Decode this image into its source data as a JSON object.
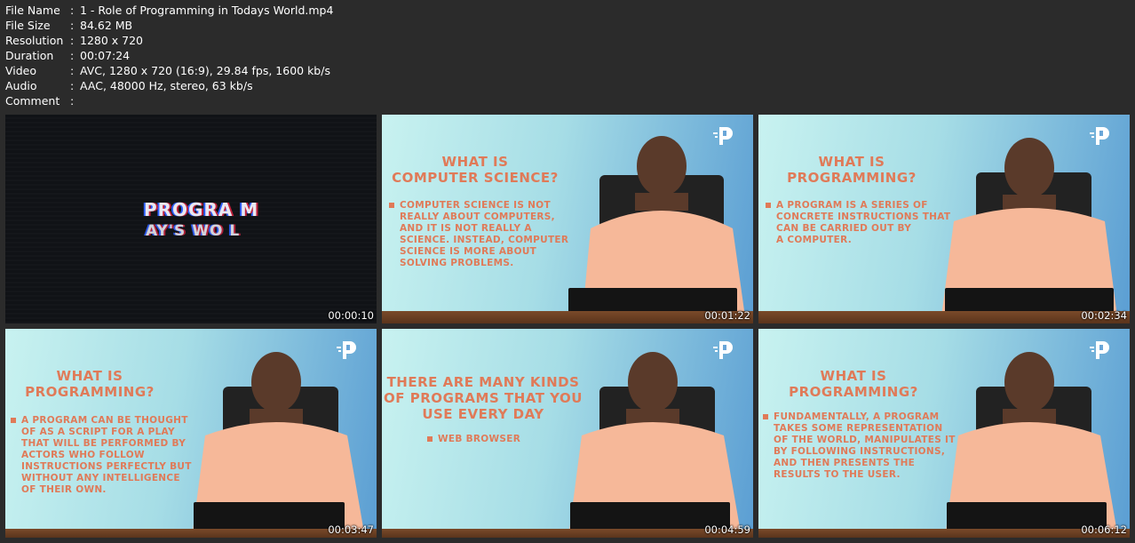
{
  "info": [
    {
      "key": "File Name",
      "value": "1 - Role of Programming in Todays World.mp4"
    },
    {
      "key": "File Size",
      "value": "84.62 MB"
    },
    {
      "key": "Resolution",
      "value": "1280 x 720"
    },
    {
      "key": "Duration",
      "value": "00:07:24"
    },
    {
      "key": "Video",
      "value": "AVC, 1280 x 720 (16:9), 29.84 fps, 1600 kb/s"
    },
    {
      "key": "Audio",
      "value": "AAC, 48000 Hz, stereo, 63 kb/s"
    },
    {
      "key": "Comment",
      "value": ""
    }
  ],
  "colon": ":",
  "thumbs": [
    {
      "time": "00:00:10",
      "line1": "PROGRA  M",
      "line2": "AY'S WO L"
    },
    {
      "time": "00:01:22",
      "title": "WHAT IS\nCOMPUTER SCIENCE?",
      "bullet": "COMPUTER SCIENCE IS NOT\nREALLY ABOUT COMPUTERS,\nAND IT IS NOT REALLY A\nSCIENCE. INSTEAD, COMPUTER\nSCIENCE IS MORE ABOUT\nSOLVING PROBLEMS."
    },
    {
      "time": "00:02:34",
      "title": "WHAT IS\nPROGRAMMING?",
      "bullet": "A PROGRAM IS A SERIES OF\nCONCRETE INSTRUCTIONS THAT\nCAN BE CARRIED OUT BY\nA COMPUTER."
    },
    {
      "time": "00:03:47",
      "title": "WHAT IS\nPROGRAMMING?",
      "bullet": "A PROGRAM CAN BE THOUGHT\nOF AS A SCRIPT FOR A PLAY\nTHAT WILL BE PERFORMED BY\nACTORS WHO FOLLOW\nINSTRUCTIONS PERFECTLY BUT\nWITHOUT ANY INTELLIGENCE\nOF THEIR OWN."
    },
    {
      "time": "00:04:59",
      "title": "THERE ARE MANY KINDS\nOF PROGRAMS THAT YOU\nUSE EVERY DAY",
      "bullet": "WEB BROWSER"
    },
    {
      "time": "00:06:12",
      "title": "WHAT IS\nPROGRAMMING?",
      "bullet": "FUNDAMENTALLY, A PROGRAM\nTAKES SOME REPRESENTATION\nOF THE WORLD, MANIPULATES IT\nBY FOLLOWING INSTRUCTIONS,\nAND THEN PRESENTS THE\nRESULTS TO THE USER."
    }
  ],
  "colors": {
    "background": "#2b2b2b",
    "slide_text": "#e07a58",
    "shirt": "#f6b899"
  }
}
